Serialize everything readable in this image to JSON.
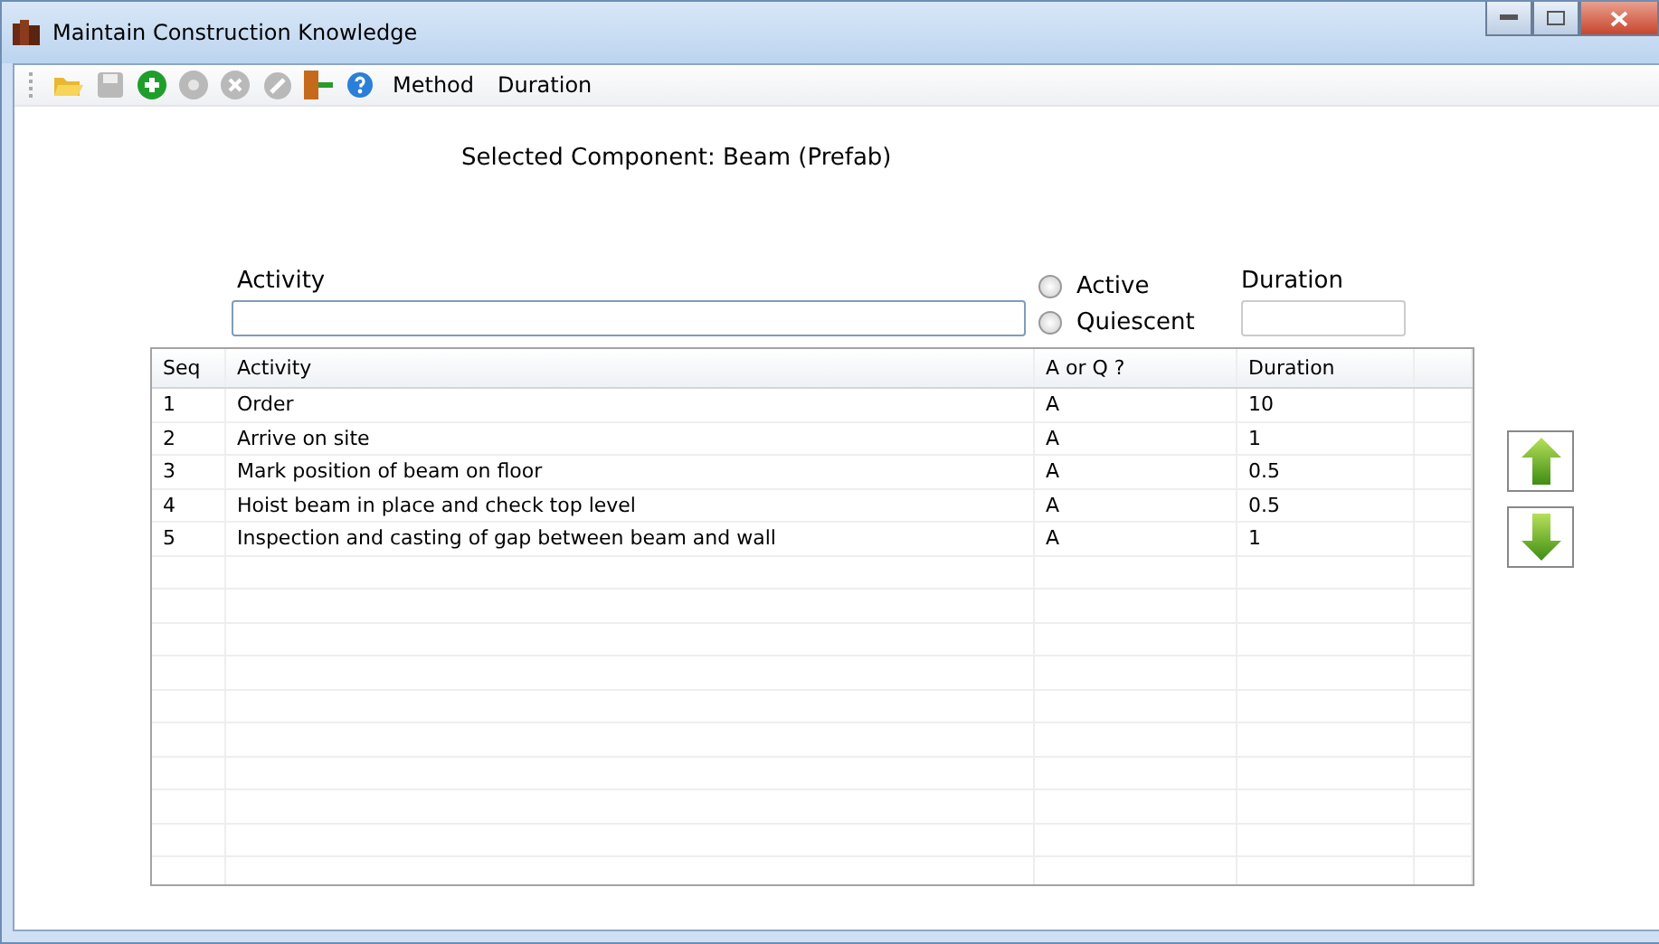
{
  "window": {
    "title": "Maintain Construction Knowledge"
  },
  "toolbar": {
    "icons": [
      {
        "kind": "open",
        "disabled": false
      },
      {
        "kind": "save",
        "disabled": true
      },
      {
        "kind": "add",
        "disabled": false
      },
      {
        "kind": "view",
        "disabled": true
      },
      {
        "kind": "delete",
        "disabled": true
      },
      {
        "kind": "edit",
        "disabled": true
      },
      {
        "kind": "exit",
        "disabled": false
      },
      {
        "kind": "help",
        "disabled": false
      }
    ],
    "menus": [
      "Method",
      "Duration"
    ]
  },
  "heading": "Selected Component: Beam (Prefab)",
  "form": {
    "activity_label": "Activity",
    "status_options": [
      {
        "label": "Active",
        "selected": false
      },
      {
        "label": "Quiescent",
        "selected": false
      }
    ],
    "duration_label": "Duration"
  },
  "table": {
    "columns": [
      "Seq",
      "Activity",
      "A or Q ?",
      "Duration"
    ],
    "rows": [
      [
        "1",
        "Order",
        "A",
        "10"
      ],
      [
        "2",
        "Arrive on site",
        "A",
        "1"
      ],
      [
        "3",
        "Mark position of beam on floor",
        "A",
        "0.5"
      ],
      [
        "4",
        "Hoist beam in place and check top level",
        "A",
        "0.5"
      ],
      [
        "5",
        "Inspection and casting of gap between beam and wall",
        "A",
        "1"
      ]
    ]
  }
}
